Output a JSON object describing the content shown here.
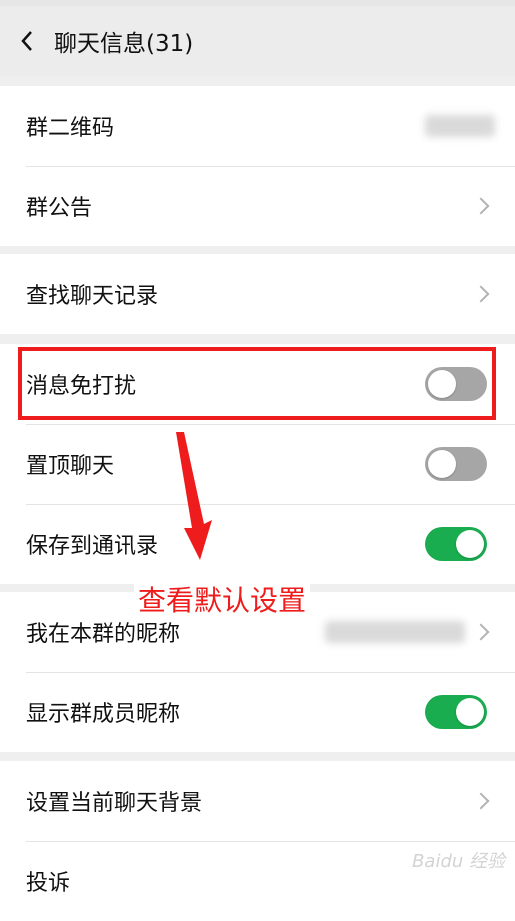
{
  "header": {
    "title": "聊天信息(31)"
  },
  "groups": {
    "g1": {
      "items": [
        {
          "label": "群二维码"
        },
        {
          "label": "群公告"
        }
      ]
    },
    "g2": {
      "items": [
        {
          "label": "查找聊天记录"
        }
      ]
    },
    "g3": {
      "items": [
        {
          "label": "消息免打扰",
          "toggle": "off"
        },
        {
          "label": "置顶聊天",
          "toggle": "off"
        },
        {
          "label": "保存到通讯录",
          "toggle": "on"
        }
      ]
    },
    "g4": {
      "items": [
        {
          "label": "我在本群的昵称"
        },
        {
          "label": "显示群成员昵称",
          "toggle": "on"
        }
      ]
    },
    "g5": {
      "items": [
        {
          "label": "设置当前聊天背景"
        },
        {
          "label": "投诉"
        }
      ]
    }
  },
  "annotation": {
    "text": "查看默认设置",
    "color": "#ee1c1c"
  },
  "colors": {
    "toggle_on": "#1aad50",
    "toggle_off": "#a6a6a6",
    "annotation_red": "#ee1c1c"
  },
  "watermark": {
    "text": "Baidu 经验"
  }
}
